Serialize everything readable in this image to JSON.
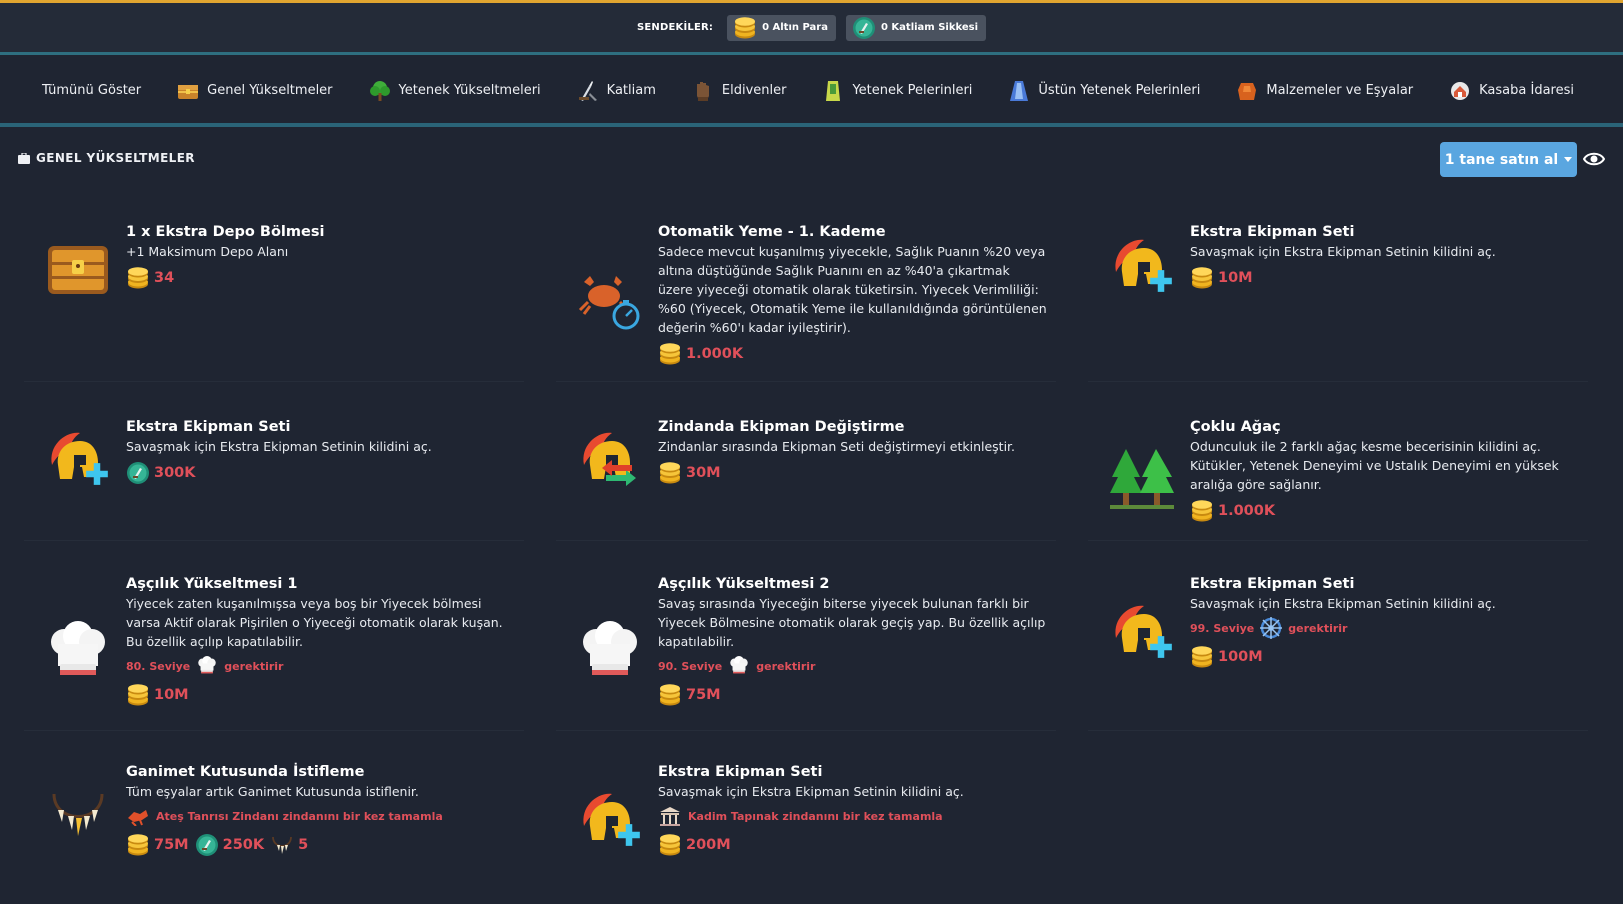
{
  "wallet": {
    "label": "SENDEKİLER:",
    "gold": "0 Altın Para",
    "slaughter": "0 Katliam Sikkesi"
  },
  "nav": [
    {
      "label": "Tümünü Göster",
      "icon": "none"
    },
    {
      "label": "Genel Yükseltmeler",
      "icon": "chest-icon"
    },
    {
      "label": "Yetenek Yükseltmeleri",
      "icon": "tree-icon"
    },
    {
      "label": "Katliam",
      "icon": "sword-icon"
    },
    {
      "label": "Eldivenler",
      "icon": "glove-icon"
    },
    {
      "label": "Yetenek Pelerinleri",
      "icon": "cape-icon"
    },
    {
      "label": "Üstün Yetenek Pelerinleri",
      "icon": "superior-cape-icon"
    },
    {
      "label": "Malzemeler ve Eşyalar",
      "icon": "material-icon"
    },
    {
      "label": "Kasaba İdaresi",
      "icon": "town-icon"
    }
  ],
  "section": {
    "title": "GENEL YÜKSELTMELER",
    "buy_button": "1 tane satın al"
  },
  "colors": {
    "background": "#1f2532",
    "accent_gold": "#e0a530",
    "cost_red": "#e0505a",
    "button_blue": "#5aa6e0"
  },
  "cards": [
    {
      "title": "1 x Ekstra Depo Bölmesi",
      "desc": "+1 Maksimum Depo Alanı",
      "icon": "chest-icon",
      "costs": [
        {
          "icon": "gold-coin-icon",
          "value": "34"
        }
      ]
    },
    {
      "title": "Otomatik Yeme - 1. Kademe",
      "desc": "Sadece mevcut kuşanılmış yiyecekle, Sağlık Puanın %20 veya altına düştüğünde Sağlık Puanını en az %40'a çıkartmak üzere yiyeceği otomatik olarak tüketirsin. Yiyecek Verimliliği: %60 (Yiyecek, Otomatik Yeme ile kullanıldığında görüntülenen değerin %60'ı kadar iyileştirir).",
      "icon": "crab-timer-icon",
      "costs": [
        {
          "icon": "gold-coin-icon",
          "value": "1.000K"
        }
      ]
    },
    {
      "title": "Ekstra Ekipman Seti",
      "desc": "Savaşmak için Ekstra Ekipman Setinin kilidini aç.",
      "icon": "helmet-plus-icon",
      "costs": [
        {
          "icon": "gold-coin-icon",
          "value": "10M"
        }
      ]
    },
    {
      "title": "Ekstra Ekipman Seti",
      "desc": "Savaşmak için Ekstra Ekipman Setinin kilidini aç.",
      "icon": "helmet-plus-icon",
      "costs": [
        {
          "icon": "slayer-coin-icon",
          "value": "300K"
        }
      ]
    },
    {
      "title": "Zindanda Ekipman Değiştirme",
      "desc": "Zindanlar sırasında Ekipman Seti değiştirmeyi etkinleştir.",
      "icon": "helmet-swap-icon",
      "costs": [
        {
          "icon": "gold-coin-icon",
          "value": "30M"
        }
      ]
    },
    {
      "title": "Çoklu Ağaç",
      "desc": "Odunculuk ile 2 farklı ağaç kesme becerisinin kilidini aç. Kütükler, Yetenek Deneyimi ve Ustalık Deneyimi en yüksek aralığa göre sağlanır.",
      "icon": "trees-icon",
      "costs": [
        {
          "icon": "gold-coin-icon",
          "value": "1.000K"
        }
      ]
    },
    {
      "title": "Aşçılık Yükseltmesi 1",
      "desc": "Yiyecek zaten kuşanılmışsa veya boş bir Yiyecek bölmesi varsa Aktif olarak Pişirilen o Yiyeceği otomatik olarak kuşan. Bu özellik açılıp kapatılabilir.",
      "icon": "chef-hat-icon",
      "requirement": {
        "pre": "80. Seviye",
        "icon": "chef-hat-icon",
        "post": "gerektirir"
      },
      "costs": [
        {
          "icon": "gold-coin-icon",
          "value": "10M"
        }
      ]
    },
    {
      "title": "Aşçılık Yükseltmesi 2",
      "desc": "Savaş sırasında Yiyeceğin biterse yiyecek bulunan farklı bir Yiyecek Bölmesine otomatik olarak geçiş yap. Bu özellik açılıp kapatılabilir.",
      "icon": "chef-hat-icon",
      "requirement": {
        "pre": "90. Seviye",
        "icon": "chef-hat-icon",
        "post": "gerektirir"
      },
      "costs": [
        {
          "icon": "gold-coin-icon",
          "value": "75M"
        }
      ]
    },
    {
      "title": "Ekstra Ekipman Seti",
      "desc": "Savaşmak için Ekstra Ekipman Setinin kilidini aç.",
      "icon": "helmet-plus-icon",
      "requirement": {
        "pre": "99. Seviye",
        "icon": "ship-wheel-icon",
        "post": "gerektirir"
      },
      "costs": [
        {
          "icon": "gold-coin-icon",
          "value": "100M"
        }
      ]
    },
    {
      "title": "Ganimet Kutusunda İstifleme",
      "desc": "Tüm eşyalar artık Ganimet Kutusunda istiflenir.",
      "icon": "tooth-necklace-icon",
      "requirement": {
        "pre": "",
        "icon": "fire-dragon-icon",
        "post": "Ateş Tanrısı Zindanı zindanını bir kez tamamla"
      },
      "costs": [
        {
          "icon": "gold-coin-icon",
          "value": "75M"
        },
        {
          "icon": "slayer-coin-icon",
          "value": "250K"
        },
        {
          "icon": "tooth-necklace-icon",
          "value": "5"
        }
      ]
    },
    {
      "title": "Ekstra Ekipman Seti",
      "desc": "Savaşmak için Ekstra Ekipman Setinin kilidini aç.",
      "icon": "helmet-plus-icon",
      "requirement": {
        "pre": "",
        "icon": "temple-icon",
        "post": "Kadim Tapınak zindanını bir kez tamamla"
      },
      "costs": [
        {
          "icon": "gold-coin-icon",
          "value": "200M"
        }
      ]
    }
  ]
}
